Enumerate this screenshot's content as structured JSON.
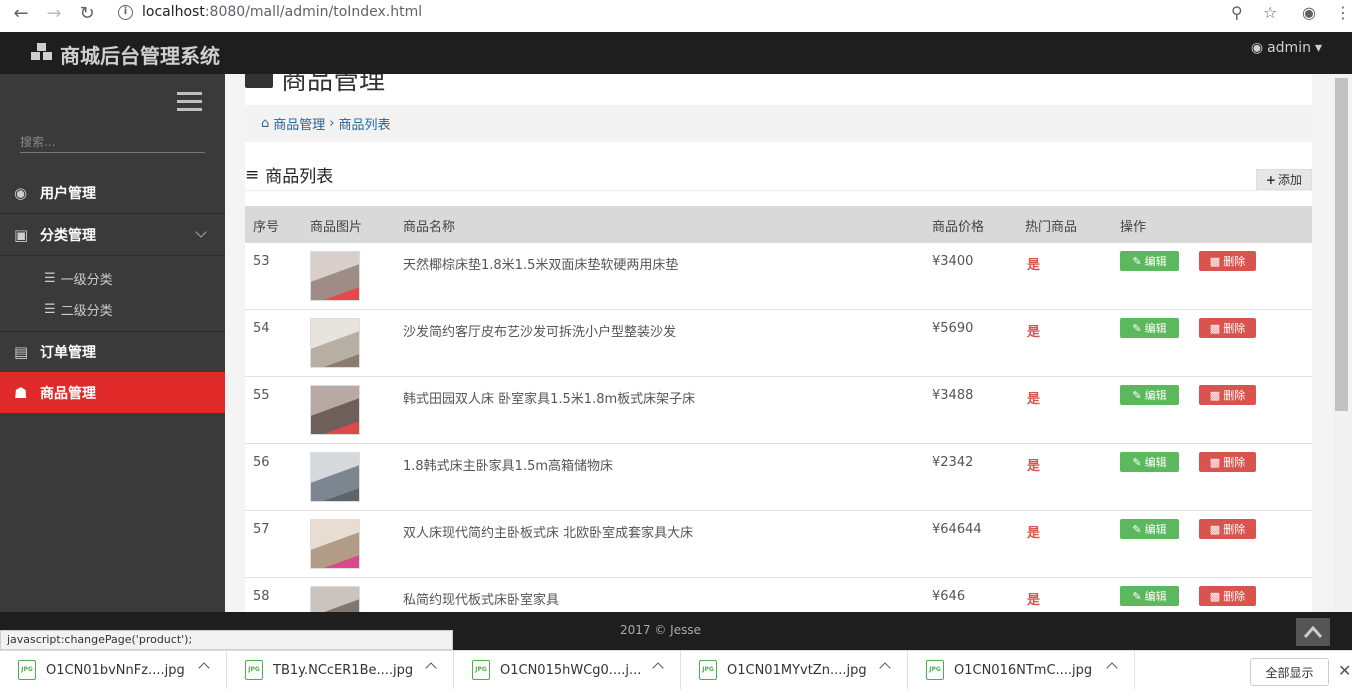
{
  "browser": {
    "url_host": "localhost",
    "url_rest": ":8080/mall/admin/toIndex.html"
  },
  "header": {
    "title": "商城后台管理系统",
    "user": "admin"
  },
  "sidebar": {
    "search_placeholder": "搜索...",
    "items": [
      {
        "label": "用户管理"
      },
      {
        "label": "分类管理"
      },
      {
        "label": "订单管理"
      },
      {
        "label": "商品管理"
      }
    ],
    "sub_items": [
      {
        "label": "一级分类"
      },
      {
        "label": "二级分类"
      }
    ]
  },
  "main": {
    "heading": "商品管理",
    "breadcrumb": [
      "商品管理",
      "商品列表"
    ],
    "list_title": "商品列表",
    "add_label": "添加",
    "columns": [
      "序号",
      "商品图片",
      "商品名称",
      "商品价格",
      "热门商品",
      "操作"
    ],
    "edit_label": "编辑",
    "delete_label": "删除",
    "rows": [
      {
        "id": "53",
        "name": "天然椰棕床垫1.8米1.5米双面床垫软硬两用床垫",
        "price": "¥3400",
        "hot": "是"
      },
      {
        "id": "54",
        "name": "沙发简约客厅皮布艺沙发可拆洗小户型整装沙发",
        "price": "¥5690",
        "hot": "是"
      },
      {
        "id": "55",
        "name": "韩式田园双人床 卧室家具1.5米1.8m板式床架子床",
        "price": "¥3488",
        "hot": "是"
      },
      {
        "id": "56",
        "name": "1.8韩式床主卧家具1.5m高箱储物床",
        "price": "¥2342",
        "hot": "是"
      },
      {
        "id": "57",
        "name": "双人床现代简约主卧板式床 北欧卧室成套家具大床",
        "price": "¥64644",
        "hot": "是"
      },
      {
        "id": "58",
        "name": "私简约现代板式床卧室家具",
        "price": "¥646",
        "hot": "是"
      }
    ]
  },
  "footer": {
    "copyright": "2017 © Jesse"
  },
  "status_url": "javascript:changePage('product');",
  "downloads": {
    "files": [
      "O1CN01bvNnFz....jpg",
      "TB1y.NCcER1Be....jpg",
      "O1CN015hWCg0....j...",
      "O1CN01MYvtZn....jpg",
      "O1CN016NTmC....jpg"
    ],
    "show_all": "全部显示"
  }
}
